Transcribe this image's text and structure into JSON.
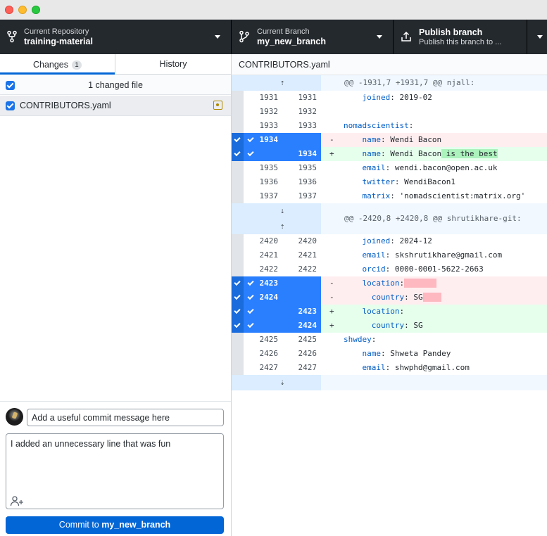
{
  "toolbar": {
    "repo": {
      "label": "Current Repository",
      "value": "training-material"
    },
    "branch": {
      "label": "Current Branch",
      "value": "my_new_branch"
    },
    "publish": {
      "label": "Publish branch",
      "description": "Publish this branch to ..."
    }
  },
  "sidebar": {
    "tabs": [
      {
        "label": "Changes",
        "count": "1"
      },
      {
        "label": "History"
      }
    ],
    "changed_summary": "1 changed file",
    "files": [
      {
        "name": "CONTRIBUTORS.yaml",
        "status": "modified"
      }
    ]
  },
  "commit": {
    "summary_placeholder": "Add a useful commit message here",
    "description": "I added an unnecessary line that was fun",
    "button_prefix": "Commit to ",
    "button_branch": "my_new_branch"
  },
  "diff": {
    "file": "CONTRIBUTORS.yaml",
    "hunk1_header": "@@ -1931,7 +1931,7 @@ njall:",
    "hunk2_header": "@@ -2420,8 +2420,8 @@ shrutikhare-git:",
    "expand_up": "⇡",
    "expand_down": "⇣",
    "lines": [
      {
        "old": "1931",
        "new": "1931",
        "key": "    joined",
        "val": " 2019-02"
      },
      {
        "old": "1932",
        "new": "1932"
      },
      {
        "old": "1933",
        "new": "1933",
        "key": "nomadscientist",
        "val": ""
      },
      {
        "old": "1934",
        "new": "",
        "marker": "-",
        "key": "    name",
        "val": " Wendi Bacon"
      },
      {
        "old": "",
        "new": "1934",
        "marker": "+",
        "key": "    name",
        "val": " Wendi Bacon",
        "added": " is the best"
      },
      {
        "old": "1935",
        "new": "1935",
        "key": "    email",
        "val": " wendi.bacon@open.ac.uk"
      },
      {
        "old": "1936",
        "new": "1936",
        "key": "    twitter",
        "val": " WendiBacon1"
      },
      {
        "old": "1937",
        "new": "1937",
        "key": "    matrix",
        "val": " 'nomadscientist:matrix.org'"
      },
      {
        "old": "2420",
        "new": "2420",
        "key": "    joined",
        "val": " 2024-12"
      },
      {
        "old": "2421",
        "new": "2421",
        "key": "    email",
        "val": " skshrutikhare@gmail.com"
      },
      {
        "old": "2422",
        "new": "2422",
        "key": "    orcid",
        "val": " 0000-0001-5622-2663"
      },
      {
        "old": "2423",
        "new": "",
        "marker": "-",
        "key": "    location",
        "val": ""
      },
      {
        "old": "2424",
        "new": "",
        "marker": "-",
        "key": "      country",
        "val": " SG"
      },
      {
        "old": "",
        "new": "2423",
        "marker": "+",
        "key": "    location",
        "val": ""
      },
      {
        "old": "",
        "new": "2424",
        "marker": "+",
        "key": "      country",
        "val": " SG"
      },
      {
        "old": "2425",
        "new": "2425",
        "key": "shwdey",
        "val": ""
      },
      {
        "old": "2426",
        "new": "2426",
        "key": "    name",
        "val": " Shweta Pandey"
      },
      {
        "old": "2427",
        "new": "2427",
        "key": "    email",
        "val": " shwphd@gmail.com"
      }
    ]
  }
}
